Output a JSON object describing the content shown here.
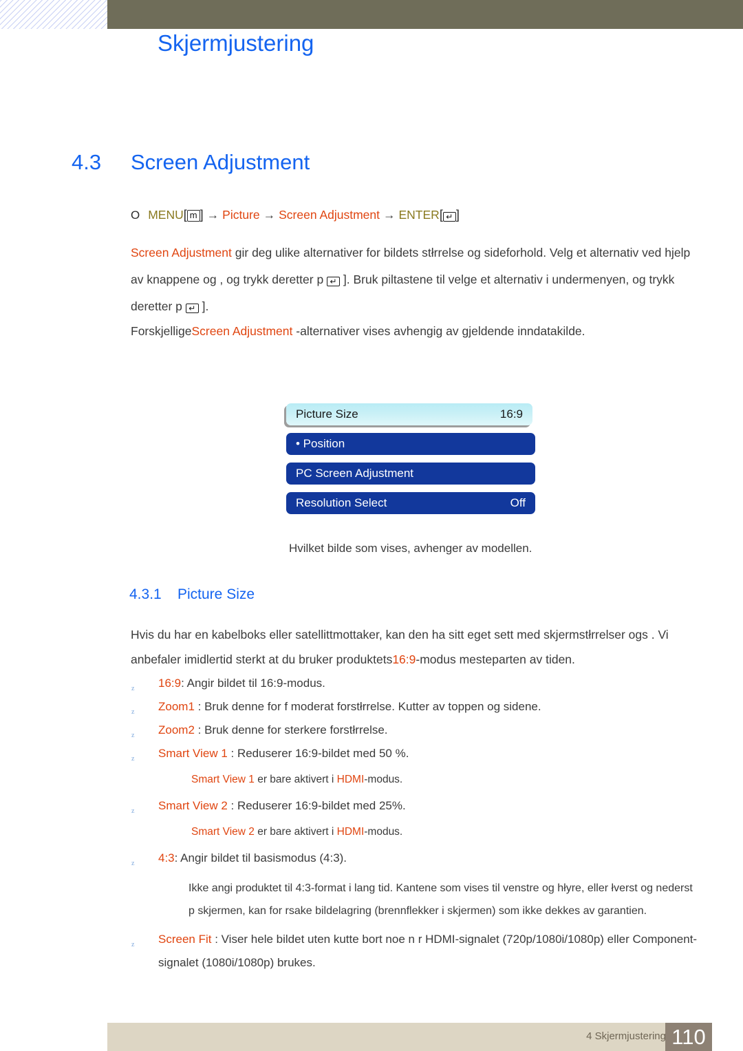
{
  "header": {
    "chapter_title": "Skjermjustering"
  },
  "section": {
    "number": "4.3",
    "title": "Screen Adjustment"
  },
  "navpath": {
    "bullet": "O",
    "menu": "MENU",
    "menu_key": "m",
    "arrow": "→",
    "picture": "Picture",
    "screen_adjustment": "Screen Adjustment",
    "enter": "ENTER",
    "enter_key": "↵",
    "bracket_open": "[",
    "bracket_close": "]"
  },
  "paragraphs": {
    "p1_a": "Screen Adjustment",
    "p1_b": " gir deg ulike alternativer for bildets stłrrelse og sideforhold. Velg et alternativ ved hjelp av knappene      og    , og trykk deretter p  ",
    "p1_c": " ]. Bruk piltastene til   velge et alternativ i undermenyen, og trykk deretter p  ",
    "p1_d": " ].",
    "p2_a": "Forskjellige",
    "p2_b": "Screen Adjustment",
    "p2_c": " -alternativer vises avhengig av gjeldende inndatakilde.",
    "p3_a": "Hvis du har en kabelboks eller satellittmottaker, kan den ha sitt eget sett med skjermstłrrelser ogs . Vi anbefaler imidlertid sterkt at du bruker produktets",
    "p3_b": "16:9",
    "p3_c": "-modus mesteparten av tiden."
  },
  "osd": {
    "rows": [
      {
        "label": "Picture Size",
        "value": "16:9",
        "state": "selected"
      },
      {
        "label": "• Position",
        "value": "",
        "state": "normal"
      },
      {
        "label": "PC Screen Adjustment",
        "value": "",
        "state": "normal"
      },
      {
        "label": "Resolution Select",
        "value": "Off",
        "state": "normal"
      }
    ],
    "caption": "Hvilket bilde som vises, avhenger av modellen."
  },
  "subsection": {
    "number": "4.3.1",
    "title": "Picture Size"
  },
  "bullets": {
    "marker": "z",
    "items": [
      {
        "term": "16:9",
        "rest": ": Angir bildet til 16:9-modus."
      },
      {
        "term": "Zoom1",
        "rest": " : Bruk denne for   f  moderat forstłrrelse. Kutter av toppen og sidene."
      },
      {
        "term": "Zoom2",
        "rest": " : Bruk denne for sterkere forstłrrelse."
      },
      {
        "term": "Smart View 1",
        "rest": " : Reduserer 16:9-bildet med 50 %."
      },
      {
        "term": "Smart View 2",
        "rest": " : Reduserer 16:9-bildet med 25%."
      },
      {
        "term": "4:3",
        "rest": ": Angir bildet til basismodus (4:3)."
      },
      {
        "term": "Screen Fit",
        "rest": " : Viser hele bildet uten   kutte bort noe n r HDMI-signalet (720p/1080i/1080p) eller Component-signalet (1080i/1080p) brukes."
      }
    ],
    "note_sv1_a": "Smart View 1",
    "note_sv1_b": " er bare aktivert i ",
    "note_sv1_c": "HDMI",
    "note_sv1_d": "-modus.",
    "note_sv2_a": "Smart View 2",
    "note_sv2_b": " er bare aktivert i ",
    "note_sv2_c": "HDMI",
    "note_sv2_d": "-modus.",
    "note_43": "Ikke angi produktet til 4:3-format i lang tid. Kantene som vises til venstre og hłyre, eller łverst og nederst p  skjermen, kan for rsake bildelagring (brennflekker i skjermen) som ikke dekkes av garantien."
  },
  "footer": {
    "text": "4 Skjermjustering",
    "page": "110"
  },
  "colors": {
    "heading_blue": "#1464f0",
    "accent_red": "#e04510",
    "menu_gold": "#8a7a20",
    "osd_blue": "#12389c",
    "osd_selected": "#c9f0f6",
    "header_olive": "#6f6d59",
    "footer_beige": "#ddd6c4",
    "page_box": "#8d8174"
  }
}
